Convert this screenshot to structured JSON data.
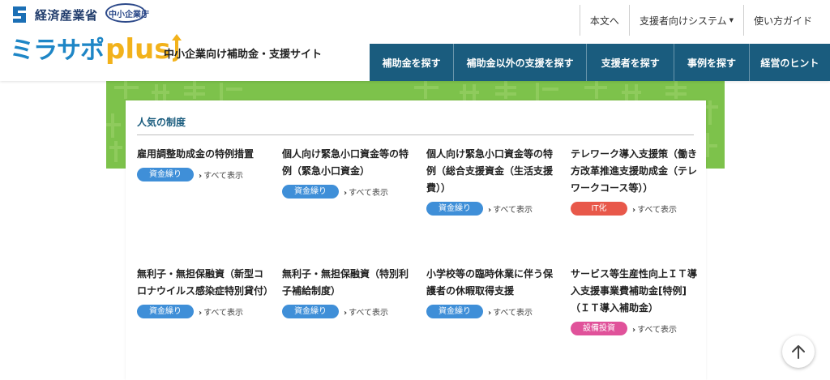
{
  "header": {
    "ministry_name": "経済産業省",
    "sme_agency_label": "中小企業庁",
    "site_logo_kana": "ミラサポ",
    "site_logo_plus": "plus",
    "tagline": "中小企業向け補助金・支援サイト",
    "util_nav": [
      {
        "label": "本文へ"
      },
      {
        "label": "支援者向けシステム",
        "dropdown": true
      },
      {
        "label": "使い方ガイド"
      }
    ],
    "main_nav": [
      {
        "label": "補助金を探す"
      },
      {
        "label": "補助金以外の支援を探す"
      },
      {
        "label": "支援者を探す"
      },
      {
        "label": "事例を探す"
      },
      {
        "label": "経営のヒント"
      }
    ]
  },
  "popular": {
    "section_title": "人気の制度",
    "show_all_label": "すべて表示",
    "items": [
      {
        "title": "雇用調整助成金の特例措置",
        "badge": "資金繰り",
        "badge_color": "#3f8fd8"
      },
      {
        "title": "個人向け緊急小口資金等の特例（緊急小口資金）",
        "badge": "資金繰り",
        "badge_color": "#3f8fd8"
      },
      {
        "title": "個人向け緊急小口資金等の特例（総合支援資金（生活支援費））",
        "badge": "資金繰り",
        "badge_color": "#3f8fd8"
      },
      {
        "title": "テレワーク導入支援策（働き方改革推進支援助成金（テレワークコース等））",
        "badge": "IT化",
        "badge_color": "#e8584a"
      },
      {
        "title": "無利子・無担保融資（新型コロナウイルス感染症特別貸付）",
        "badge": "資金繰り",
        "badge_color": "#3f8fd8"
      },
      {
        "title": "無利子・無担保融資（特別利子補給制度）",
        "badge": "資金繰り",
        "badge_color": "#3f8fd8"
      },
      {
        "title": "小学校等の臨時休業に伴う保護者の休暇取得支援",
        "badge": "資金繰り",
        "badge_color": "#3f8fd8"
      },
      {
        "title": "サービス等生産性向上ＩＴ導入支援事業費補助金[特例]（ＩＴ導入補助金）",
        "badge": "設備投資",
        "badge_color": "#e0529a"
      }
    ]
  },
  "colors": {
    "nav_bg": "#1a5c7e",
    "banner_green": "#7dc24b",
    "accent_blue": "#1e86c6",
    "accent_yellow": "#f2b21b"
  }
}
